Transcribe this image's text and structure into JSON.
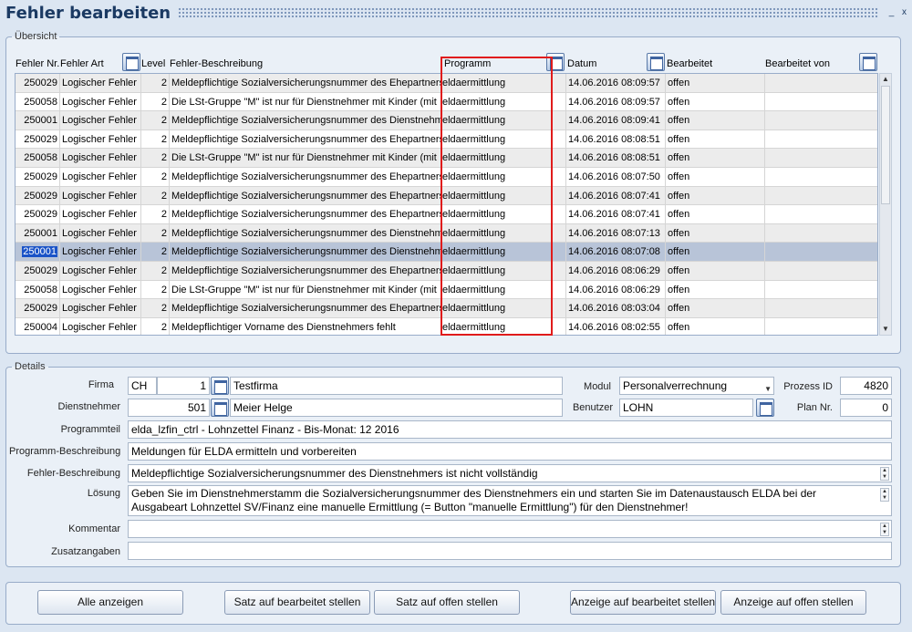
{
  "window": {
    "title": "Fehler bearbeiten",
    "min_label": "_",
    "close_label": "x"
  },
  "overview": {
    "legend": "Übersicht",
    "columns": [
      "Fehler Nr.",
      "Fehler Art",
      "Level",
      "Fehler-Beschreibung",
      "Programm",
      "Datum",
      "Bearbeitet",
      "Bearbeitet von"
    ],
    "rows": [
      [
        "250029",
        "Logischer Fehler",
        "2",
        "Meldepflichtige Sozialversicherungsnummer des Ehepartners",
        "eldaermittlung",
        "14.06.2016 08:09:57",
        "offen",
        ""
      ],
      [
        "250058",
        "Logischer Fehler",
        "2",
        "Die LSt-Gruppe \"M\" ist nur für Dienstnehmer mit Kinder (mit",
        "eldaermittlung",
        "14.06.2016 08:09:57",
        "offen",
        ""
      ],
      [
        "250001",
        "Logischer Fehler",
        "2",
        "Meldepflichtige Sozialversicherungsnummer des Dienstnehmers",
        "eldaermittlung",
        "14.06.2016 08:09:41",
        "offen",
        ""
      ],
      [
        "250029",
        "Logischer Fehler",
        "2",
        "Meldepflichtige Sozialversicherungsnummer des Ehepartners",
        "eldaermittlung",
        "14.06.2016 08:08:51",
        "offen",
        ""
      ],
      [
        "250058",
        "Logischer Fehler",
        "2",
        "Die LSt-Gruppe \"M\" ist nur für Dienstnehmer mit Kinder (mit",
        "eldaermittlung",
        "14.06.2016 08:08:51",
        "offen",
        ""
      ],
      [
        "250029",
        "Logischer Fehler",
        "2",
        "Meldepflichtige Sozialversicherungsnummer des Ehepartners",
        "eldaermittlung",
        "14.06.2016 08:07:50",
        "offen",
        ""
      ],
      [
        "250029",
        "Logischer Fehler",
        "2",
        "Meldepflichtige Sozialversicherungsnummer des Ehepartners",
        "eldaermittlung",
        "14.06.2016 08:07:41",
        "offen",
        ""
      ],
      [
        "250029",
        "Logischer Fehler",
        "2",
        "Meldepflichtige Sozialversicherungsnummer des Ehepartners",
        "eldaermittlung",
        "14.06.2016 08:07:41",
        "offen",
        ""
      ],
      [
        "250001",
        "Logischer Fehler",
        "2",
        "Meldepflichtige Sozialversicherungsnummer des Dienstnehmers",
        "eldaermittlung",
        "14.06.2016 08:07:13",
        "offen",
        ""
      ],
      [
        "250001",
        "Logischer Fehler",
        "2",
        "Meldepflichtige Sozialversicherungsnummer des Dienstnehmers",
        "eldaermittlung",
        "14.06.2016 08:07:08",
        "offen",
        ""
      ],
      [
        "250029",
        "Logischer Fehler",
        "2",
        "Meldepflichtige Sozialversicherungsnummer des Ehepartners",
        "eldaermittlung",
        "14.06.2016 08:06:29",
        "offen",
        ""
      ],
      [
        "250058",
        "Logischer Fehler",
        "2",
        "Die LSt-Gruppe \"M\" ist nur für Dienstnehmer mit Kinder (mit",
        "eldaermittlung",
        "14.06.2016 08:06:29",
        "offen",
        ""
      ],
      [
        "250029",
        "Logischer Fehler",
        "2",
        "Meldepflichtige Sozialversicherungsnummer des Ehepartners",
        "eldaermittlung",
        "14.06.2016 08:03:04",
        "offen",
        ""
      ],
      [
        "250004",
        "Logischer Fehler",
        "2",
        "Meldepflichtiger Vorname des Dienstnehmers fehlt",
        "eldaermittlung",
        "14.06.2016 08:02:55",
        "offen",
        ""
      ]
    ],
    "selected_row": 9
  },
  "details": {
    "legend": "Details",
    "firma_label": "Firma",
    "firma_code": "CH",
    "firma_nr": "1",
    "firma_name": "Testfirma",
    "modul_label": "Modul",
    "modul_value": "Personalverrechnung",
    "prozess_label": "Prozess ID",
    "prozess_value": "4820",
    "dn_label": "Dienstnehmer",
    "dn_nr": "501",
    "dn_name": "Meier Helge",
    "benutzer_label": "Benutzer",
    "benutzer_value": "LOHN",
    "plan_label": "Plan Nr.",
    "plan_value": "0",
    "programmteil_label": "Programmteil",
    "programmteil_value": "elda_lzfin_ctrl - Lohnzettel Finanz - Bis-Monat: 12 2016",
    "pb_label": "Programm-Beschreibung",
    "pb_value": "Meldungen für ELDA ermitteln und vorbereiten",
    "fb_label": "Fehler-Beschreibung",
    "fb_value": "Meldepflichtige Sozialversicherungsnummer des Dienstnehmers ist nicht vollständig",
    "loesung_label": "Lösung",
    "loesung_value": "Geben Sie im Dienstnehmerstamm die Sozialversicherungsnummer des Dienstnehmers ein und starten Sie im Datenaustausch ELDA bei der Ausgabeart Lohnzettel SV/Finanz eine manuelle Ermittlung (= Button \"manuelle Ermittlung\") für den Dienstnehmer!",
    "kommentar_label": "Kommentar",
    "kommentar_value": "",
    "zusatz_label": "Zusatzangaben",
    "zusatz_value": ""
  },
  "buttons": {
    "show_all": "Alle anzeigen",
    "set_done": "Satz auf bearbeitet stellen",
    "set_open": "Satz auf offen stellen",
    "view_done": "Anzeige auf bearbeitet stellen",
    "view_open": "Anzeige auf offen stellen"
  }
}
